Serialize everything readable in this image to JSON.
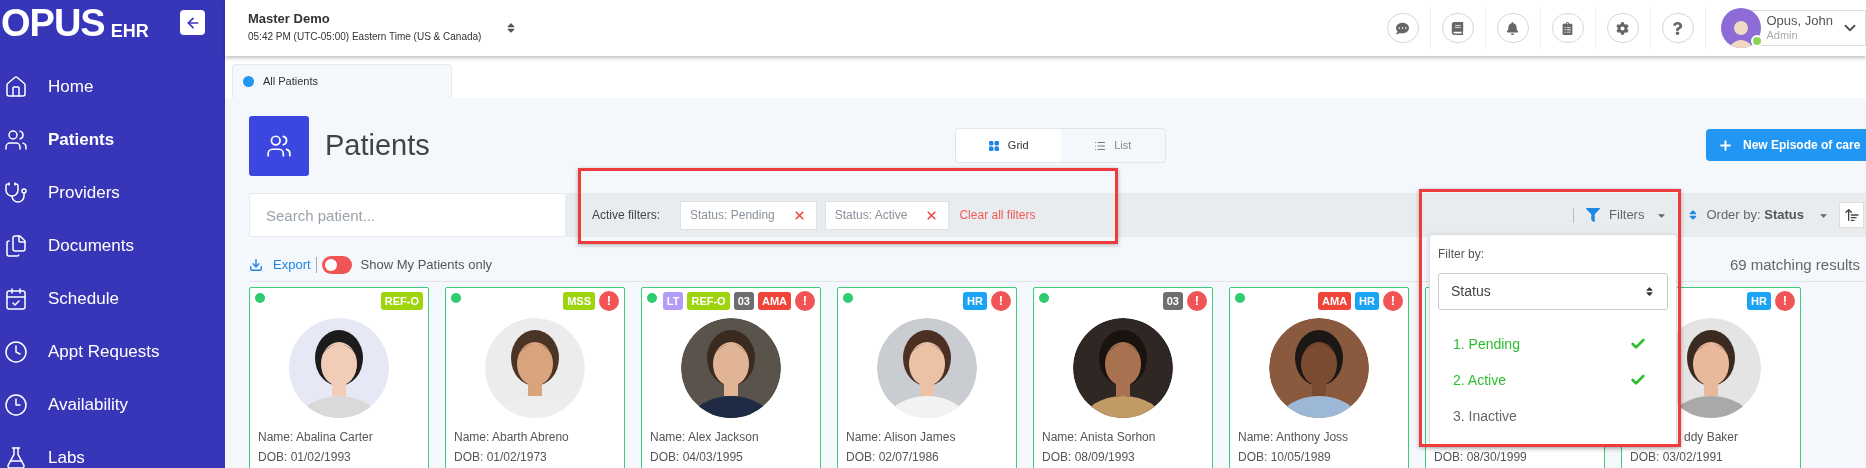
{
  "sidebar": {
    "logo": {
      "main": "OPUS",
      "sub": "EHR"
    },
    "items": [
      {
        "label": "Home",
        "selected": false
      },
      {
        "label": "Patients",
        "selected": true
      },
      {
        "label": "Providers",
        "selected": false
      },
      {
        "label": "Documents",
        "selected": false
      },
      {
        "label": "Schedule",
        "selected": false
      },
      {
        "label": "Appt Requests",
        "selected": false
      },
      {
        "label": "Availability",
        "selected": false
      },
      {
        "label": "Labs",
        "selected": false
      }
    ]
  },
  "header": {
    "title": "Master Demo",
    "subtitle": "05:42 PM (UTC-05:00) Eastern Time (US & Canada)"
  },
  "user": {
    "name": "Opus, John",
    "role": "Admin",
    "online": true
  },
  "tabs": [
    {
      "label": "All Patients",
      "selected": true
    }
  ],
  "page": {
    "title": "Patients",
    "views": [
      {
        "label": "Grid",
        "selected": true
      },
      {
        "label": "List",
        "selected": false
      }
    ],
    "new_button": "New Episode of care"
  },
  "search": {
    "placeholder": "Search patient..."
  },
  "active_filters": {
    "label": "Active filters:",
    "chips": [
      "Status: Pending",
      "Status: Active"
    ],
    "clear": "Clear all filters"
  },
  "filters_button": "Filters",
  "order": {
    "label": "Order by:",
    "value": "Status"
  },
  "filter_menu": {
    "label": "Filter by:",
    "field": "Status",
    "options": [
      {
        "label": "1. Pending",
        "checked": true
      },
      {
        "label": "2. Active",
        "checked": true
      },
      {
        "label": "3. Inactive",
        "checked": false
      }
    ]
  },
  "export": "Export",
  "my_patients": {
    "label": "Show My Patients only",
    "on": false
  },
  "results": "69 matching results",
  "cards": [
    {
      "online": true,
      "photo": {
        "kind": "picture"
      },
      "badges": [
        {
          "kind": "tag",
          "text": "REF-O",
          "color": "#9ed40c"
        }
      ],
      "name": "Name: Abalina Carter",
      "dob": "DOB: 01/02/1993"
    },
    {
      "online": true,
      "photo": {
        "kind": "picture"
      },
      "badges": [
        {
          "kind": "tag",
          "text": "MSS",
          "color": "#9ed40c"
        },
        {
          "kind": "alert",
          "text": "!",
          "color": "#f05454"
        }
      ],
      "name": "Name: Abarth Abreno",
      "dob": "DOB: 01/02/1973"
    },
    {
      "online": true,
      "photo": {
        "kind": "picture"
      },
      "badges": [
        {
          "kind": "tag",
          "text": "LT",
          "color": "#b39cf7"
        },
        {
          "kind": "tag",
          "text": "REF-O",
          "color": "#9ed40c"
        },
        {
          "kind": "tag",
          "text": "03",
          "color": "#6e6e6e"
        },
        {
          "kind": "tag",
          "text": "AMA",
          "color": "#f04438"
        },
        {
          "kind": "alert",
          "text": "!",
          "color": "#f05454"
        }
      ],
      "name": "Name: Alex Jackson",
      "dob": "DOB: 04/03/1995"
    },
    {
      "online": true,
      "photo": {
        "kind": "picture"
      },
      "badges": [
        {
          "kind": "tag",
          "text": "HR",
          "color": "#1aa3f5"
        },
        {
          "kind": "alert",
          "text": "!",
          "color": "#f05454"
        }
      ],
      "name": "Name: Alison James",
      "dob": "DOB: 02/07/1986"
    },
    {
      "online": true,
      "photo": {
        "kind": "picture"
      },
      "badges": [
        {
          "kind": "tag",
          "text": "03",
          "color": "#6e6e6e"
        },
        {
          "kind": "alert",
          "text": "!",
          "color": "#f05454"
        }
      ],
      "name": "Name: Anista Sorhon",
      "dob": "DOB: 08/09/1993"
    },
    {
      "online": true,
      "photo": {
        "kind": "picture"
      },
      "badges": [
        {
          "kind": "tag",
          "text": "AMA",
          "color": "#f04438"
        },
        {
          "kind": "tag",
          "text": "HR",
          "color": "#1aa3f5"
        },
        {
          "kind": "alert",
          "text": "!",
          "color": "#f05454"
        }
      ],
      "name": "Name: Anthony Joss",
      "dob": "DOB: 10/05/1989"
    },
    {
      "dob": "DOB: 08/30/1999"
    },
    {
      "photo": {
        "kind": "picture"
      },
      "badges": [
        {
          "kind": "tag",
          "text": "HR",
          "color": "#1aa3f5"
        },
        {
          "kind": "alert",
          "text": "!",
          "color": "#f05454"
        }
      ],
      "name": "ddy Baker",
      "name_cut": true,
      "dob": "DOB: 03/02/1991"
    }
  ]
}
